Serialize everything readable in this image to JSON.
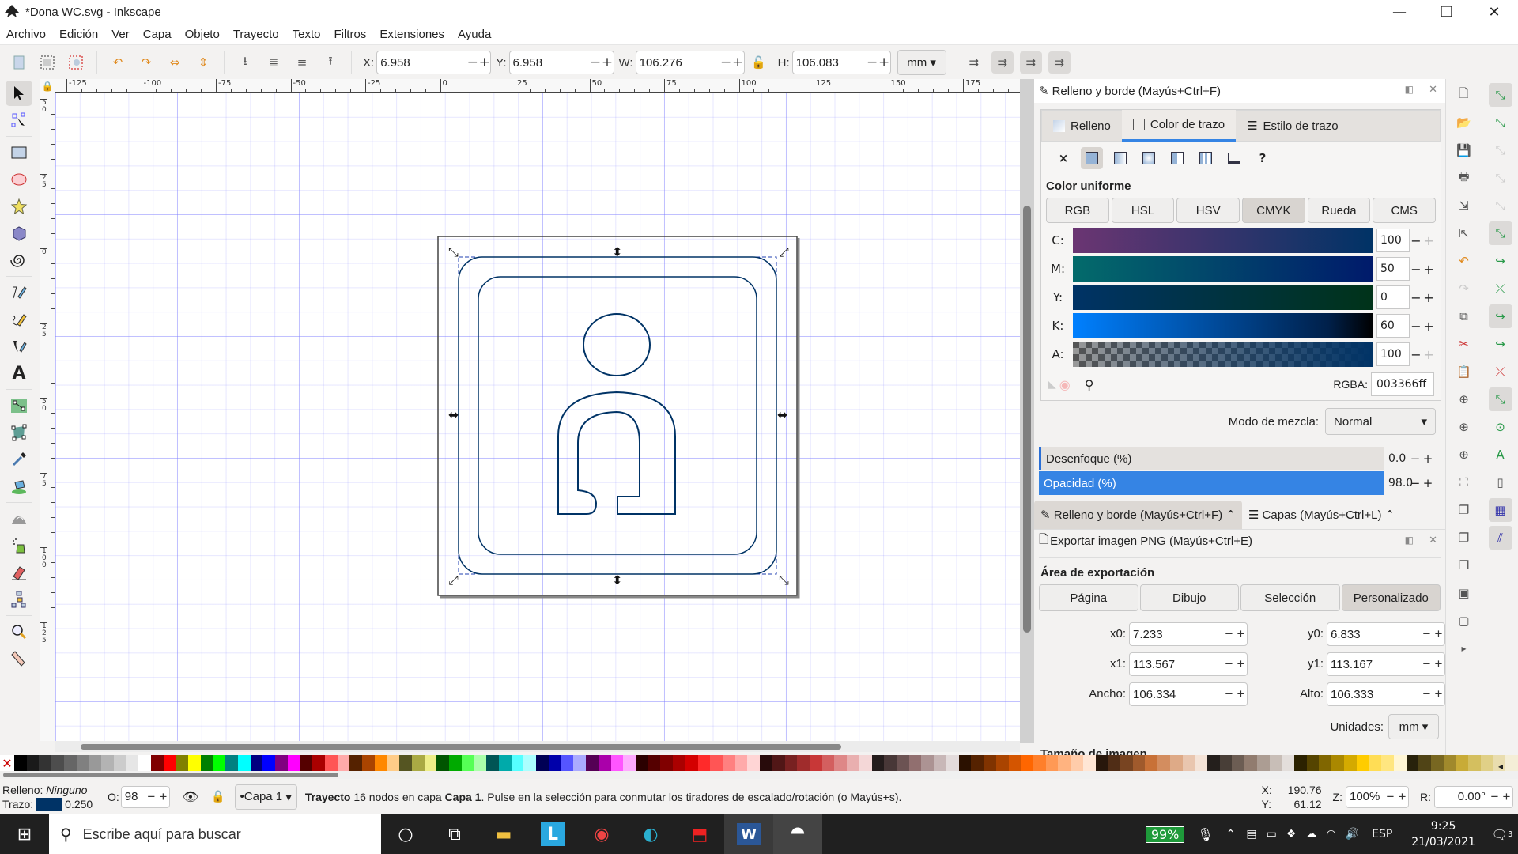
{
  "window": {
    "title": "*Dona WC.svg - Inkscape",
    "minimize_icon": "—",
    "maximize_icon": "❐",
    "close_icon": "✕"
  },
  "menu": [
    "Archivo",
    "Edición",
    "Ver",
    "Capa",
    "Objeto",
    "Trayecto",
    "Texto",
    "Filtros",
    "Extensiones",
    "Ayuda"
  ],
  "toolbar": {
    "x_label": "X:",
    "x_value": "6.958",
    "y_label": "Y:",
    "y_value": "6.958",
    "w_label": "W:",
    "w_value": "106.276",
    "h_label": "H:",
    "h_value": "106.083",
    "unit": "mm",
    "minus": "−",
    "plus": "+"
  },
  "ruler": {
    "h_ticks": [
      "-125",
      "-100",
      "-75",
      "-50",
      "-25",
      "0",
      "25",
      "50",
      "75",
      "100",
      "125",
      "150",
      "175"
    ],
    "v_ticks": [
      "50",
      "25",
      "0",
      "25",
      "50",
      "75",
      "100",
      "125"
    ]
  },
  "fill_stroke": {
    "header": "Relleno y borde (Mayús+Ctrl+F)",
    "tabs": [
      "Relleno",
      "Color de trazo",
      "Estilo de trazo"
    ],
    "active_tab": 1,
    "paint_none": "×",
    "paint_unknown": "?",
    "color_section": "Color uniforme",
    "modes": [
      "RGB",
      "HSL",
      "HSV",
      "CMYK",
      "Rueda",
      "CMS"
    ],
    "active_mode": 3,
    "sliders": [
      {
        "label": "C:",
        "value": "100"
      },
      {
        "label": "M:",
        "value": "50"
      },
      {
        "label": "Y:",
        "value": "0"
      },
      {
        "label": "K:",
        "value": "60"
      },
      {
        "label": "A:",
        "value": "100"
      }
    ],
    "rgba_label": "RGBA:",
    "rgba_value": "003366ff",
    "blend_label": "Modo de mezcla:",
    "blend_value": "Normal",
    "blur_label": "Desenfoque (%)",
    "blur_value": "0.0",
    "opacity_label": "Opacidad (%)",
    "opacity_value": "98.0"
  },
  "dock_tabs": [
    "Relleno y borde (Mayús+Ctrl+F)",
    "Capas (Mayús+Ctrl+L)"
  ],
  "export": {
    "header": "Exportar imagen PNG (Mayús+Ctrl+E)",
    "area_title": "Área de exportación",
    "area_buttons": [
      "Página",
      "Dibujo",
      "Selección",
      "Personalizado"
    ],
    "active_area": 3,
    "x0_label": "x0:",
    "x0": "7.233",
    "y0_label": "y0:",
    "y0": "6.833",
    "x1_label": "x1:",
    "x1": "113.567",
    "y1_label": "y1:",
    "y1": "113.167",
    "width_label": "Ancho:",
    "width": "106.334",
    "height_label": "Alto:",
    "height": "106.333",
    "units_label": "Unidades:",
    "units": "mm",
    "size_title": "Tamaño de imagen"
  },
  "status": {
    "fill_label": "Relleno:",
    "fill_value": "Ninguno",
    "stroke_label": "Trazo:",
    "stroke_width": "0.250",
    "stroke_color": "#003366",
    "opacity_label": "O:",
    "opacity_value": "98",
    "layer": "•Capa 1",
    "message_bold": "Trayecto",
    "message": " 16 nodos en capa ",
    "message_layer": "Capa 1",
    "message_tail": ". Pulse en la selección para conmutar los tiradores de escalado/rotación (o Mayús+s).",
    "x_label": "X:",
    "x": "190.76",
    "y_label": "Y:",
    "y": "61.12",
    "zoom_label": "Z:",
    "zoom": "100%",
    "rot_label": "R:",
    "rotation": "0.00°"
  },
  "taskbar": {
    "search_placeholder": "Escribe aquí para buscar",
    "battery": "99%",
    "language": "ESP",
    "time": "9:25",
    "date": "21/03/2021",
    "notifications": "3"
  },
  "colors": {
    "stroke": "#003366",
    "accent": "#3584e4"
  }
}
